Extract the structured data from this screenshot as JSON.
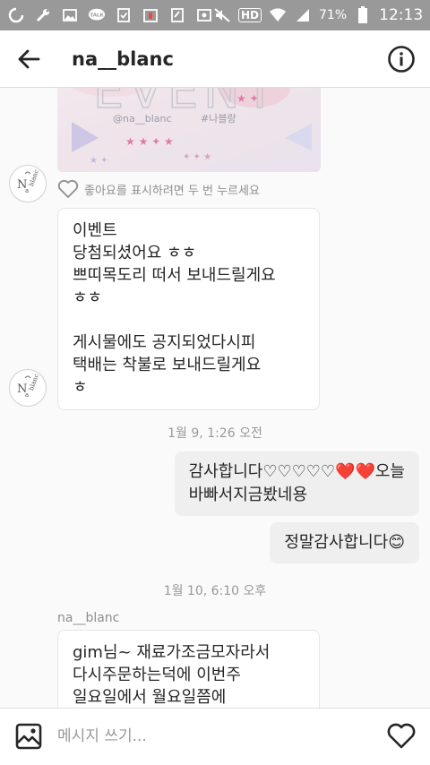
{
  "status_bar": {
    "battery_pct": "71%",
    "time": "12:13",
    "hd_label": "HD",
    "talk_label": "TALK"
  },
  "header": {
    "title": "na__blanc"
  },
  "event_image": {
    "text_event": "EVENT",
    "text_handle": "@na__blanc",
    "text_hashtag": "#나블랑"
  },
  "like_hint": "좋아요를 표시하려면 두 번 누르세요",
  "messages": {
    "incoming_1": {
      "lines": [
        "이벤트",
        "당첨되셨어요 ㅎㅎ",
        "쁘띠목도리 떠서 보내드릴게요",
        "ㅎㅎ",
        "",
        "게시물에도 공지되었다시피",
        "택배는 착불로 보내드릴게요",
        "ㅎ"
      ]
    },
    "timestamp_1": "1월 9, 1:26 오전",
    "outgoing_1": {
      "lines": [
        "감사합니다♡♡♡♡♡❤️❤️오늘",
        "바빠서지금봤네용"
      ]
    },
    "outgoing_2": {
      "text": "정말감사합니다😊"
    },
    "timestamp_2": "1월 10, 6:10 오후",
    "sender_name": "na__blanc",
    "incoming_2": {
      "lines": [
        "gim님~ 재료가조금모자라서",
        "다시주문하는덕에 이번주",
        "일요일에서 월요일쯤에"
      ]
    }
  },
  "composer": {
    "placeholder": "메시지 쓰기..."
  },
  "colors": {
    "status_bar_bg": "#999999",
    "header_bg": "#ffffff",
    "chat_bg": "#fafafa",
    "bubble_in_bg": "#ffffff",
    "bubble_out_bg": "#efefef",
    "text_primary": "#262626",
    "text_secondary": "#999999"
  },
  "icons": {
    "back": "arrow-left-icon",
    "info": "info-circle-icon",
    "gallery": "image-icon",
    "heart": "heart-outline-icon",
    "like": "heart-outline-icon"
  }
}
